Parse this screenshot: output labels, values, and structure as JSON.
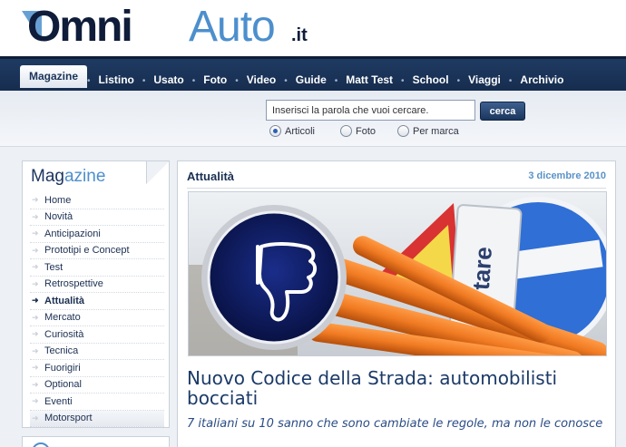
{
  "brand": {
    "name_part1": "Omni",
    "name_part2": "Auto",
    "tld": ".it"
  },
  "nav": {
    "tabs": [
      "Magazine",
      "Listino",
      "Usato",
      "Foto",
      "Video",
      "Guide",
      "Matt Test",
      "School",
      "Viaggi",
      "Archivio"
    ],
    "active": "Magazine"
  },
  "search": {
    "value": "Inserisci la parola che vuoi cercare.",
    "button": "cerca",
    "options": [
      {
        "label": "Articoli",
        "selected": true
      },
      {
        "label": "Foto",
        "selected": false
      },
      {
        "label": "Per marca",
        "selected": false
      }
    ]
  },
  "sidebar": {
    "title_part1": "Mag",
    "title_part2": "azine",
    "items": [
      "Home",
      "Novità",
      "Anticipazioni",
      "Prototipi e Concept",
      "Test",
      "Retrospettive",
      "Attualità",
      "Mercato",
      "Curiosità",
      "Tecnica",
      "Fuorigiri",
      "Optional",
      "Eventi",
      "Motorsport"
    ],
    "active": "Attualità"
  },
  "article": {
    "section": "Attualità",
    "date": "3 dicembre 2010",
    "title": "Nuovo Codice della Strada: automobilisti bocciati",
    "subtitle": "7 italiani su 10 sanno che sono cambiate le regole, ma non le conosce",
    "hero_sign_text": "tare"
  },
  "colors": {
    "navy": "#1f3a62",
    "accent_blue": "#4d8fcd",
    "orange_pipe": "#f07a22",
    "thumb_bg": "#0c1a5e"
  }
}
